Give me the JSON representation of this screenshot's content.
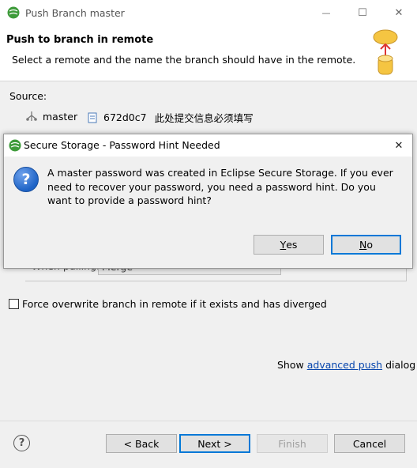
{
  "window": {
    "title": "Push Branch master",
    "minimize_glyph": "—",
    "maximize_glyph": "☐",
    "close_glyph": "✕"
  },
  "banner": {
    "heading": "Push to branch in remote",
    "description": "Select a remote and the name the branch should have in the remote."
  },
  "source": {
    "label": "Source:",
    "branch": "master",
    "commit_id": "672d0c7",
    "commit_message": "此处提交信息必须填写"
  },
  "pull": {
    "label": "When pulling:",
    "value": "Merge"
  },
  "force_checkbox": {
    "label": "Force overwrite branch in remote if it exists and has diverged",
    "checked": false
  },
  "advanced": {
    "prefix": "Show",
    "link": "advanced push",
    "suffix": "dialog"
  },
  "footer": {
    "help_glyph": "?",
    "back": "< Back",
    "next": "Next >",
    "finish": "Finish",
    "cancel": "Cancel"
  },
  "dialog": {
    "title": "Secure Storage - Password Hint Needed",
    "close_glyph": "✕",
    "question_glyph": "?",
    "message": "A master password was created in Eclipse Secure Storage. If you ever need to recover your password, you need a password hint. Do you want to provide a password hint?",
    "yes_mnemonic": "Y",
    "yes_rest": "es",
    "no_mnemonic": "N",
    "no_rest": "o"
  },
  "colors": {
    "accent": "#0078d7",
    "link": "#0645ad",
    "question_icon": "#1e63c6",
    "eclipse_logo": "#4caf50"
  }
}
